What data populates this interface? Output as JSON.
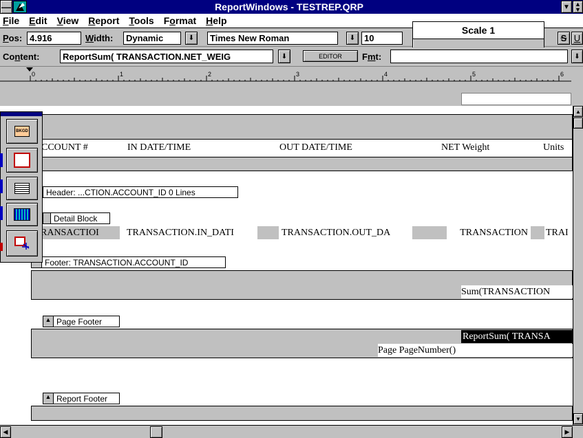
{
  "titlebar": {
    "title": "ReportWindows - TESTREP.QRP"
  },
  "menu": {
    "items": [
      {
        "pre": "",
        "u": "F",
        "post": "ile"
      },
      {
        "pre": "",
        "u": "E",
        "post": "dit"
      },
      {
        "pre": "",
        "u": "V",
        "post": "iew"
      },
      {
        "pre": "",
        "u": "R",
        "post": "eport"
      },
      {
        "pre": "",
        "u": "T",
        "post": "ools"
      },
      {
        "pre": "F",
        "u": "o",
        "post": "rmat"
      },
      {
        "pre": "",
        "u": "H",
        "post": "elp"
      }
    ]
  },
  "scale_popup": {
    "title": "Scale 1"
  },
  "toolbar1": {
    "pos_label": "Pos:",
    "pos_value": "4.916",
    "width_label": "Width:",
    "width_value": "Dynamic",
    "font_value": "Times New Roman",
    "size_value": "10",
    "strike_label": "S",
    "underline_label": "U"
  },
  "toolbar2": {
    "content_label": "Content:",
    "content_value": "ReportSum( TRANSACTION.NET_WEIG",
    "editor_label": "EDITOR",
    "fmt_label": "Fmt:",
    "fmt_value": ""
  },
  "ruler": {
    "marks": [
      "0",
      "1",
      "2",
      "3",
      "4",
      "5",
      "6"
    ],
    "sub_marks": [
      "0",
      "1"
    ]
  },
  "palette": {
    "bkgd_label": "BKGD"
  },
  "report": {
    "columns": [
      "CCOUNT #",
      "IN DATE/TIME",
      "OUT DATE/TIME",
      "NET Weight",
      "Units"
    ],
    "header_band": "Header: ...CTION.ACCOUNT_ID    0 Lines",
    "detail_band": "Detail Block",
    "detail_fields": [
      "RANSACTIOI",
      "TRANSACTION.IN_DATI",
      "TRANSACTION.OUT_DA",
      "TRANSACTION",
      "TRAI"
    ],
    "footer_band": "Footer: TRANSACTION.ACCOUNT_ID",
    "footer_sum": "Sum(TRANSACTION",
    "page_footer_band": "Page Footer",
    "page_footer_sum": "ReportSum( TRANSA",
    "page_number": "Page PageNumber()",
    "report_footer_band": "Report Footer"
  }
}
